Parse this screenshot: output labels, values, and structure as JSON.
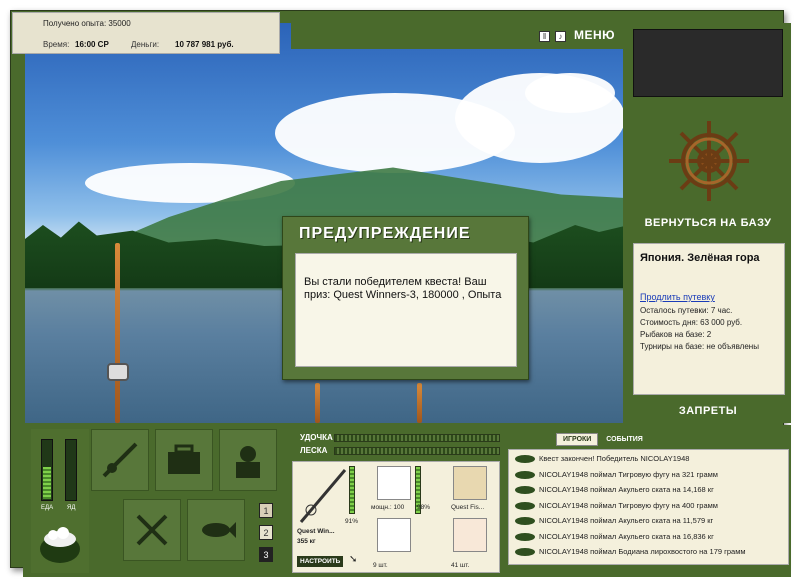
{
  "hud": {
    "xp_text": "Получено опыта: 35000",
    "time_label": "Время:",
    "time_value": "16:00 СР",
    "money_label": "Деньги:",
    "money_value": "10 787 981 руб.",
    "menu_label": "МЕНЮ",
    "pause_icon": "pause-icon",
    "sound_icon": "sound-icon"
  },
  "dialog": {
    "title": "ПРЕДУПРЕЖДЕНИЕ",
    "message": "Вы стали победителем квеста! Ваш приз: Quest Winners-3, 180000 , Опыта"
  },
  "base": {
    "back_label": "ВЕРНУТЬСЯ НА БАЗУ",
    "location": "Япония. Зелёная гора",
    "extend_link": "Продлить путевку",
    "remaining": "Осталось путевки: 7 час.",
    "day_cost": "Стоимость дня: 63 000 руб.",
    "fishers": "Рыбаков на базе: 2",
    "tournaments": "Турниры на базе: не объявлены",
    "bans_label": "ЗАПРЕТЫ"
  },
  "meters": {
    "food_label": "ЕДА",
    "poison_label": "ЯД",
    "food_level": 0.55,
    "poison_level": 0.0
  },
  "pages": [
    "1",
    "2",
    "3"
  ],
  "tackle": {
    "rod_label": "УДОЧКА",
    "line_label": "ЛЕСКА",
    "rod_name": "Quest Win...",
    "rod_weight": "355 кг",
    "rod_percent": "91%",
    "reel_power": "мощн.: 100",
    "reel_percent": "98%",
    "bait_name": "Quest Fis...",
    "hooks_count": "9 шт.",
    "bait_count": "41 шт.",
    "setup_button": "НАСТРОИТЬ"
  },
  "events": {
    "tab_players": "ИГРОКИ",
    "tab_events": "СОБЫТИЯ",
    "rows": [
      "Квест закончен! Победитель NICOLAY1948",
      "NICOLAY1948 поймал Тигровую фугу на 321 грамм",
      "NICOLAY1948 поймал Акульего ската на 14,168 кг",
      "NICOLAY1948 поймал Тигровую фугу на 400 грамм",
      "NICOLAY1948 поймал Акульего ската на 11,579 кг",
      "NICOLAY1948 поймал Акульего ската на 16,836 кг",
      "NICOLAY1948 поймал Бодиана лирохвостого на 179 грамм"
    ]
  },
  "colors": {
    "panel_green": "#4a6a2c",
    "panel_cream": "#f4f0dc",
    "link_blue": "#1a3cb8"
  }
}
